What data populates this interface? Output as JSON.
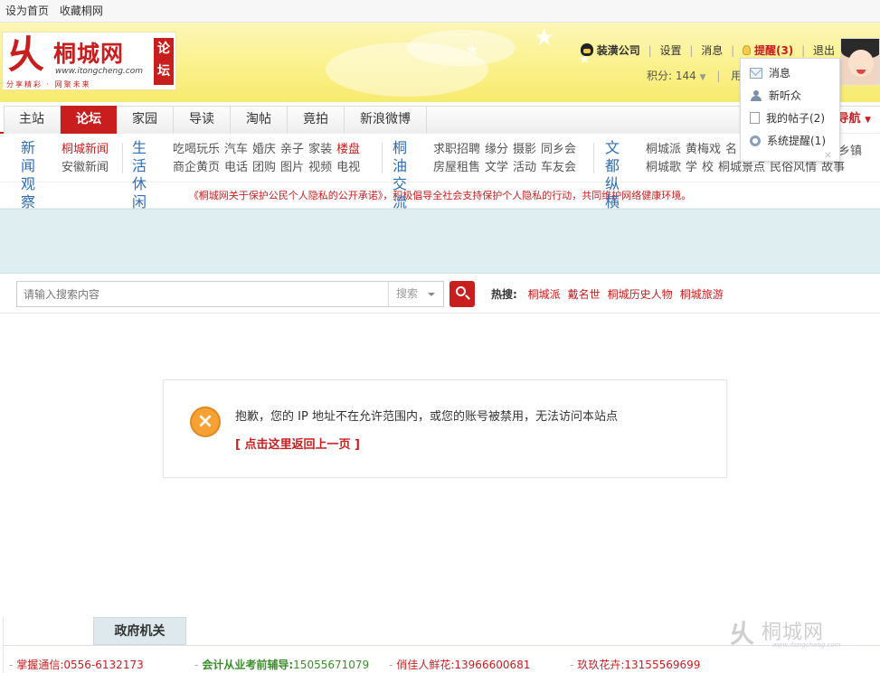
{
  "topbar": {
    "set_home": "设为首页",
    "bookmark": "收藏桐网"
  },
  "logo": {
    "mark": "乆",
    "name": "桐城网",
    "url": "www.itongcheng.com",
    "slogan": "分享精彩 · 网聚未来",
    "tag_line1": "论",
    "tag_line2": "坛"
  },
  "userbar": {
    "company": "装潢公司",
    "settings": "设置",
    "messages": "消息",
    "remind": "提醒(3)",
    "logout": "退出",
    "score": "积分: 144",
    "user_partial": "用"
  },
  "nav": {
    "items": [
      "主站",
      "论坛",
      "家园",
      "导读",
      "淘帖",
      "竟拍",
      "新浪微博"
    ],
    "active_index": 1,
    "site_nav": "导航"
  },
  "channels": {
    "g1": {
      "head1": "新闻",
      "head2": "观察",
      "row1": [
        "桐城新闻"
      ],
      "row2": [
        "安徽新闻"
      ]
    },
    "g2": {
      "head1": "生活",
      "head2": "休闲",
      "row1": [
        "吃喝玩乐",
        "汽车",
        "婚庆",
        "亲子",
        "家装",
        "楼盘"
      ],
      "row2": [
        "商企黄页",
        "电话",
        "团购",
        "图片",
        "视频",
        "电视"
      ]
    },
    "g3": {
      "head1": "桐油",
      "head2": "交流",
      "row1": [
        "求职招聘",
        "缘分",
        "摄影",
        "同乡会"
      ],
      "row2": [
        "房屋租售",
        "文学",
        "活动",
        "车友会"
      ]
    },
    "g4": {
      "head1": "文都",
      "head2": "纵横",
      "row1": [
        "桐城派",
        "黄梅戏",
        "名"
      ],
      "row2": [
        "桐城歌",
        "学",
        "校",
        "桐城景点",
        "民俗风情",
        "故事"
      ],
      "row1_tail": "乡镇"
    }
  },
  "notice": "《桐城网关于保护公民个人隐私的公开承诺》，积极倡导全社会支持保护个人隐私的行动，共同维护网络健康环境。",
  "search": {
    "placeholder": "请输入搜索内容",
    "type": "搜索",
    "hot_label": "热搜:",
    "hot_keywords": [
      "桐城派",
      "戴名世",
      "桐城历史人物",
      "桐城旅游"
    ]
  },
  "error": {
    "message": "抱歉，您的 IP 地址不在允许范围内，或您的账号被禁用，无法访问本站点",
    "back_link": "[ 点击这里返回上一页 ]"
  },
  "footer": {
    "gov_tab": "政府机关",
    "ads": [
      {
        "name": "掌握通信",
        "value": "0556-6132173",
        "style": "red"
      },
      {
        "name": "会计从业考前辅导",
        "value": "15055671079",
        "style": "green"
      },
      {
        "name": "俏佳人鲜花",
        "value": "13966600681",
        "style": "red"
      },
      {
        "name": "玖玖花卉",
        "value": "13155569699",
        "style": "red"
      }
    ],
    "watermark_mark": "乆",
    "watermark_name": "桐城网",
    "watermark_url": "www.itongcheng.com"
  },
  "popup": {
    "items": [
      {
        "label": "消息",
        "icon": "mail-icon"
      },
      {
        "label": "新听众",
        "icon": "person-icon"
      },
      {
        "label": "我的帖子(2)",
        "icon": "document-icon"
      },
      {
        "label": "系统提醒(1)",
        "icon": "gear-icon"
      }
    ],
    "close": "×"
  }
}
